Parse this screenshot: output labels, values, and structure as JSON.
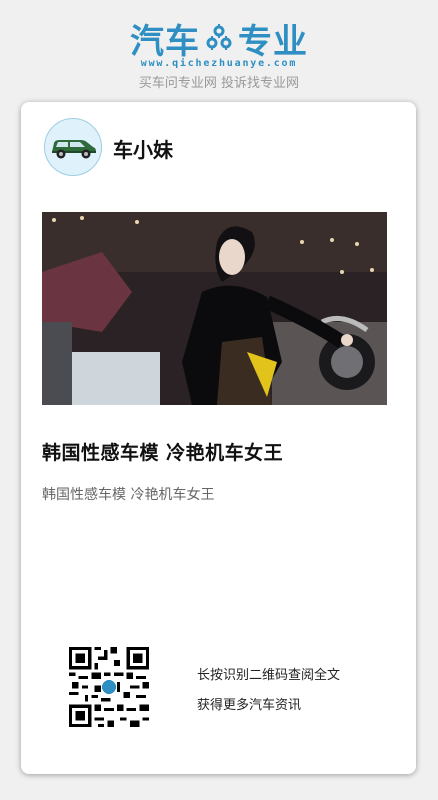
{
  "header": {
    "logo_left": "汽车",
    "logo_icon": "gear-cluster-icon",
    "logo_right": "专业",
    "url": "www.qichezhuanye.com",
    "slogan": "买车问专业网 投诉找专业网",
    "brand_color": "#2f8fc3"
  },
  "author": {
    "name": "车小妹",
    "avatar_icon": "green-suv-icon"
  },
  "article": {
    "title": "韩国性感车模 冷艳机车女王",
    "summary": "韩国性感车模 冷艳机车女王",
    "image_alt": "Motor-show model in glossy black outfit beside a motorcycle"
  },
  "footer": {
    "qr_icon": "qr-code-icon",
    "line1": "长按识别二维码查阅全文",
    "line2": "获得更多汽车资讯"
  }
}
